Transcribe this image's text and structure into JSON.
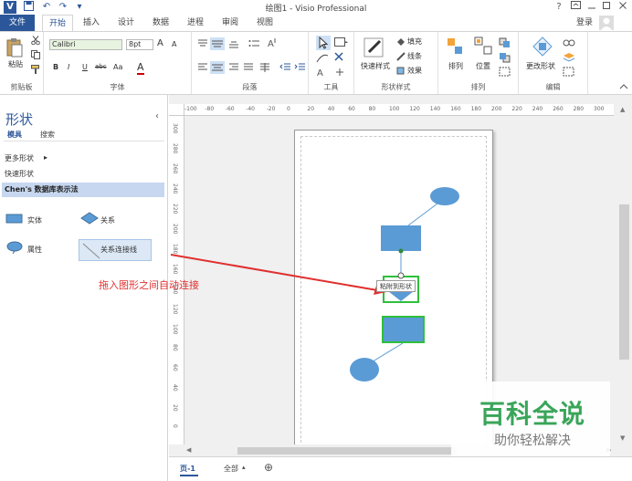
{
  "window": {
    "title": "绘图1 - Visio Professional",
    "help_label": "?",
    "login_label": "登录"
  },
  "quick_access": [
    "V",
    "💾",
    "↶",
    "↷",
    "▾"
  ],
  "tabs": [
    "文件",
    "开始",
    "插入",
    "设计",
    "数据",
    "进程",
    "审阅",
    "视图"
  ],
  "active_tab": "开始",
  "ribbon": {
    "clipboard": {
      "paste_label": "粘贴",
      "group_label": "剪贴板"
    },
    "font": {
      "font_name": "Calibri",
      "font_size": "8pt",
      "group_label": "字体",
      "bold": "B",
      "italic": "I",
      "underline": "U",
      "strike": "abc",
      "case": "Aa",
      "color": "A",
      "grow": "A",
      "shrink": "A"
    },
    "paragraph": {
      "group_label": "段落"
    },
    "tools": {
      "group_label": "工具"
    },
    "shape_style": {
      "quick_style_label": "快速样式",
      "fill_label": "填充",
      "line_label": "线条",
      "effect_label": "效果",
      "group_label": "形状样式"
    },
    "arrange": {
      "arrange_label": "排列",
      "position_label": "位置",
      "group_label": "排列"
    },
    "editing": {
      "change_shape_label": "更改形状",
      "group_label": "编辑"
    }
  },
  "shapes_panel": {
    "title": "形状",
    "tabs": [
      "模具",
      "搜索"
    ],
    "more_shapes": "更多形状",
    "quick_shapes": "快速形状",
    "stencil_name": "Chen's 数据库表示法",
    "shapes": [
      {
        "name": "实体",
        "icon": "rect"
      },
      {
        "name": "关系",
        "icon": "diamond"
      },
      {
        "name": "属性",
        "icon": "ellipse"
      },
      {
        "name": "关系连接线",
        "icon": "line"
      }
    ]
  },
  "ruler": {
    "h_ticks": [
      "-100",
      "-80",
      "-60",
      "-40",
      "-20",
      "0",
      "20",
      "40",
      "60",
      "80",
      "100",
      "120",
      "140",
      "160",
      "180",
      "200",
      "220",
      "240",
      "260",
      "280",
      "300"
    ],
    "v_ticks": [
      "300",
      "280",
      "260",
      "240",
      "220",
      "200",
      "180",
      "160",
      "140",
      "120",
      "100",
      "80",
      "60",
      "40",
      "20",
      "0"
    ]
  },
  "canvas": {
    "tooltip": "粘附到形状",
    "annotation": "拖入图形之间自动连接",
    "colors": {
      "shape_fill": "#5b9bd5",
      "selection": "#2fbf3c",
      "arrow": "#e03030"
    }
  },
  "status": {
    "page_tab": "页-1",
    "all_pages": "全部",
    "add_page": "⊕"
  },
  "watermark": {
    "title": "百科全说",
    "subtitle": "助你轻松解决"
  }
}
